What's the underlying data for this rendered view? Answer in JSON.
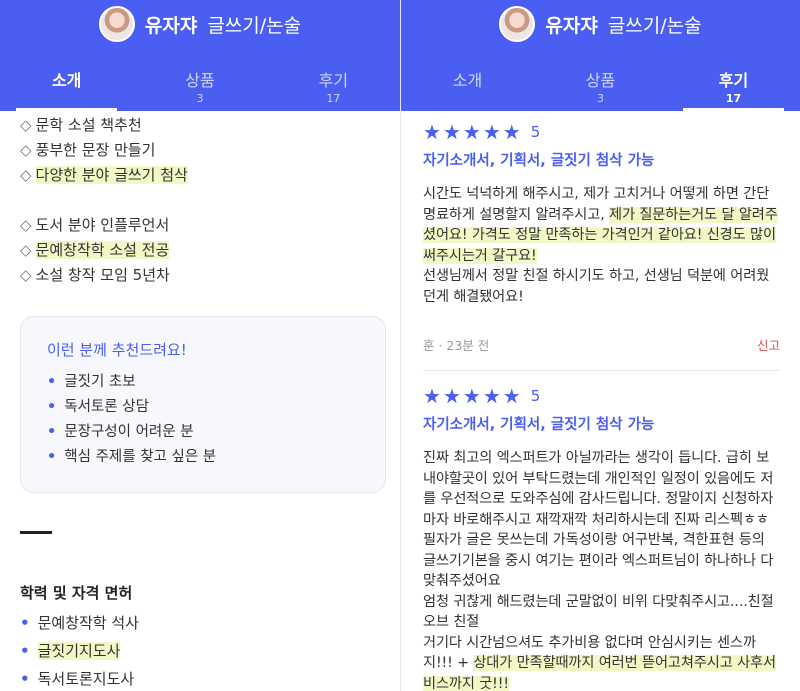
{
  "profile": {
    "name": "유자쟈",
    "category": "글쓰기/논술"
  },
  "tabs": [
    {
      "label": "소개",
      "count": ""
    },
    {
      "label": "상품",
      "count": "3"
    },
    {
      "label": "후기",
      "count": "17"
    }
  ],
  "intro": {
    "items1": [
      {
        "text": "문학 소설 책추천",
        "highlight": false
      },
      {
        "text": "풍부한 문장 만들기",
        "highlight": false
      },
      {
        "text": "다양한 분야 글쓰기 첨삭",
        "highlight": true
      }
    ],
    "items2": [
      {
        "text": "도서 분야 인플루언서",
        "highlight": false
      },
      {
        "text": "문예창작학 소설 전공",
        "highlight": true
      },
      {
        "text": "소설 창작 모임 5년차",
        "highlight": false
      }
    ],
    "diamond": "◇"
  },
  "recommend": {
    "title": "이런 분께 추천드려요!",
    "items": [
      "글짓기 초보",
      "독서토론 상담",
      "문장구성이 어려운 분",
      "핵심 주제를 찾고 싶은 분"
    ]
  },
  "certs": {
    "title": "학력 및 자격 면허",
    "items": [
      {
        "text": "문예창작학 석사",
        "highlight": false
      },
      {
        "text": "글짓기지도사",
        "highlight": true
      },
      {
        "text": "독서토론지도사",
        "highlight": false
      }
    ]
  },
  "reviews": [
    {
      "rating": "5",
      "product": "자기소개서, 기획서, 글짓기 첨삭 가능",
      "body_plain1": "시간도 넉넉하게 해주시고, 제가 고치거나 어떻게 하면 간단 명료하게 설명할지 알려주시고, ",
      "body_hl": "제가 질문하는거도 달 알려주셨어요! 가격도 정말 만족하는 가격인거 같아요! 신경도 많이 써주시는거 갈구요!",
      "body_plain2": "선생님께서 정말 친절 하시기도 하고, 선생님 덕분에 어려웠던게 해결됐어요!",
      "author": "훈 · 23분 전",
      "report": "신고"
    },
    {
      "rating": "5",
      "product": "자기소개서, 기획서, 글짓기 첨삭 가능",
      "body_plain1": "진짜 최고의 엑스퍼트가 아닐까라는 생각이 듭니다. 급히 보내야할곳이 있어 부탁드렸는데 개인적인 일정이 있음에도 저를 우선적으로 도와주심에 감사드립니다. 정말이지 신청하자마자 바로해주시고 재깍재깍 처리하시는데 진짜 리스펙ㅎㅎ\n 필자가 글은 못쓰는데 가독성이랑 어구반복, 격한표현 등의 글쓰기기본을 중시 여기는 편이라 엑스퍼트님이 하나하나 다 맞춰주셨어요\n엄청 귀찮게 해드렸는데 군말없이 비위 다맞춰주시고....친절 오브 친절\n거기다 시간넘으셔도 추가비용 없다며 안심시키는 센스까지!!! + ",
      "body_hl": "상대가 만족할때까지 여러번 뜯어고쳐주시고 사후서비스까지 굿!!!"
    }
  ],
  "colors": {
    "brand": "#4a5ff2",
    "highlight": "#f3f7c6",
    "report": "#e0505a"
  }
}
